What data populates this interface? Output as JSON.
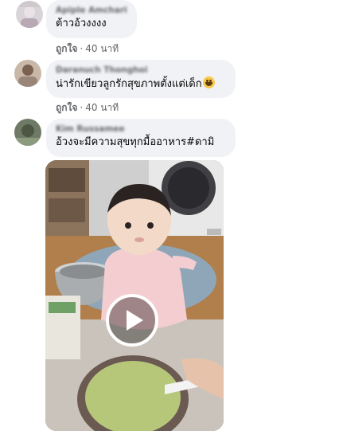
{
  "comments": [
    {
      "name": "Apiple Amchari",
      "text": "ต้าวอ้วงงงง",
      "like_label": "ถูกใจ",
      "time": "40 นาที"
    },
    {
      "name": "Daranuch Thonghoi",
      "text": "น่ารักเขียวลูกรักสุขภาพตั้งแต่เด็ก",
      "emoji": "grinning-face",
      "like_label": "ถูกใจ",
      "time": "40 นาที"
    },
    {
      "name": "Kim Russamee",
      "text": "อ้วงจะมีความสุขทุกมื้ออาหาร#ดามิ"
    }
  ],
  "separator": "·",
  "colors": {
    "bubble": "#f0f2f5",
    "secondary_text": "#65676b",
    "play_button": "#ffffff"
  }
}
